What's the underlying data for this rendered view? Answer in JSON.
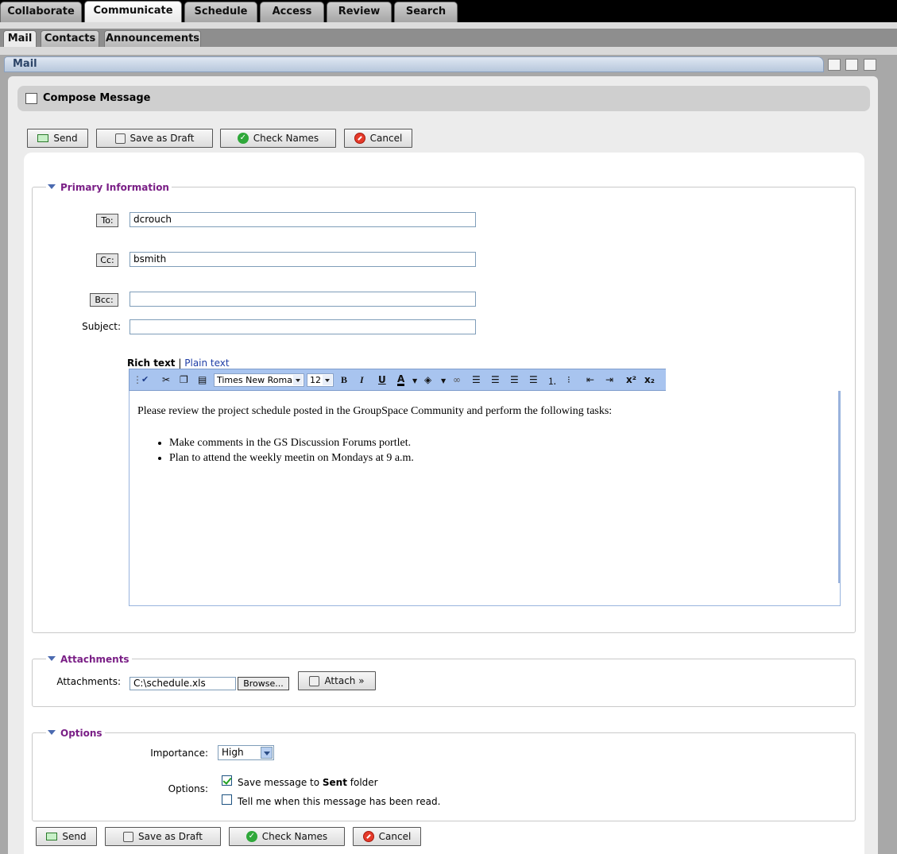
{
  "top_tabs": [
    {
      "label": "Collaborate"
    },
    {
      "label": "Communicate"
    },
    {
      "label": "Schedule"
    },
    {
      "label": "Access"
    },
    {
      "label": "Review"
    },
    {
      "label": "Search"
    }
  ],
  "sub_tabs": [
    {
      "label": "Mail"
    },
    {
      "label": "Contacts"
    },
    {
      "label": "Announcements"
    }
  ],
  "portlet": {
    "title": "Mail"
  },
  "compose": {
    "title": "Compose Message"
  },
  "toolbar": {
    "send": "Send",
    "save_draft": "Save as Draft",
    "check_names": "Check Names",
    "cancel": "Cancel"
  },
  "primary": {
    "legend": "Primary Information",
    "to_label": "To:",
    "to_value": "dcrouch",
    "cc_label": "Cc:",
    "cc_value": "bsmith",
    "bcc_label": "Bcc:",
    "bcc_value": "",
    "subject_label": "Subject:",
    "subject_value": ""
  },
  "editor": {
    "mode_rich": "Rich text",
    "mode_separator": "|",
    "mode_plain": "Plain text",
    "font": "Times New Roman",
    "size": "12",
    "body_intro": "Please review the project schedule posted in the GroupSpace Community and perform the following tasks:",
    "tasks": [
      "Make comments in the GS Discussion Forums portlet.",
      "Plan to attend the weekly meetin on Mondays at 9 a.m."
    ]
  },
  "attachments": {
    "legend": "Attachments",
    "label": "Attachments:",
    "value": "C:\\schedule.xls",
    "browse": "Browse...",
    "attach": "Attach »"
  },
  "options": {
    "legend": "Options",
    "importance_label": "Importance:",
    "importance_value": "High",
    "options_label": "Options:",
    "save_sent_prefix": "Save message to ",
    "save_sent_bold": "Sent",
    "save_sent_suffix": " folder",
    "save_sent_checked": true,
    "read_receipt": "Tell me when this message has been read.",
    "read_receipt_checked": false
  }
}
